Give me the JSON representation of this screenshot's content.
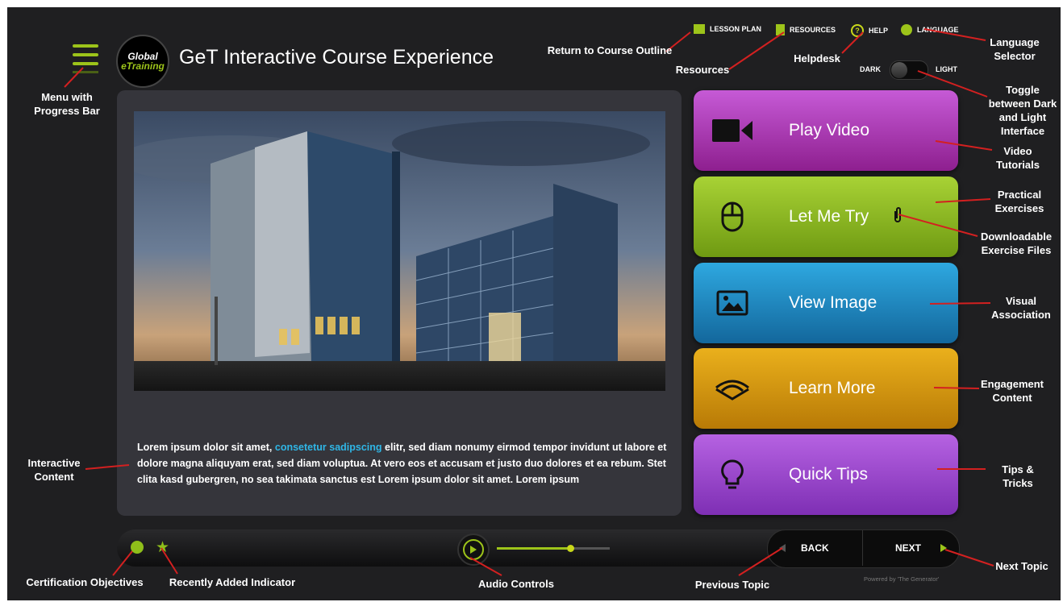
{
  "header": {
    "title": "GeT Interactive Course Experience",
    "logo_line1": "Global",
    "logo_line2": "eTraining"
  },
  "toplinks": {
    "lesson_plan": "LESSON PLAN",
    "resources": "RESOURCES",
    "help": "HELP",
    "language": "LANGUAGE"
  },
  "toggle": {
    "dark": "DARK",
    "light": "LIGHT"
  },
  "buttons": {
    "play_video": "Play Video",
    "let_me_try": "Let Me Try",
    "view_image": "View Image",
    "learn_more": "Learn More",
    "quick_tips": "Quick Tips"
  },
  "content": {
    "p1": "Lorem ipsum dolor sit amet, ",
    "highlight": "consetetur sadipscing",
    "p2": " elitr, sed diam nonumy eirmod tempor invidunt ut labore et dolore magna aliquyam erat, sed diam voluptua. At vero eos et accusam et justo duo dolores et ea rebum. Stet clita kasd gubergren, no sea takimata sanctus est Lorem ipsum dolor sit amet. Lorem ipsum"
  },
  "nav": {
    "back": "BACK",
    "next": "NEXT",
    "powered": "Powered by 'The Generator'"
  },
  "audio": {
    "progress": 0.62
  },
  "annotations": {
    "menu": "Menu with Progress Bar",
    "return": "Return to Course Outline",
    "resources": "Resources",
    "helpdesk": "Helpdesk",
    "language": "Language Selector",
    "toggle": "Toggle between Dark and Light Interface",
    "video": "Video Tutorials",
    "practical": "Practical Exercises",
    "downloadable": "Downloadable Exercise Files",
    "visual": "Visual Association",
    "engagement": "Engagement Content",
    "tips": "Tips & Tricks",
    "interactive": "Interactive Content",
    "certification": "Certification Objectives",
    "recent": "Recently Added Indicator",
    "audio": "Audio Controls",
    "previous": "Previous Topic",
    "next": "Next Topic"
  },
  "colors": {
    "accent_green": "#9dc41a",
    "link_blue": "#2fb6e6",
    "purple": "#b03fc4",
    "lime": "#8dbd1e",
    "blue": "#1d8fc9",
    "orange": "#e0a00e",
    "violet": "#a14fd0"
  }
}
